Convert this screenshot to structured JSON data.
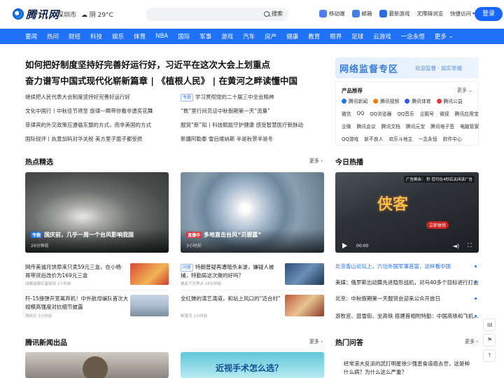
{
  "header": {
    "logo_text": "腾讯网",
    "location": "深圳市",
    "weather": "阴 29°C",
    "search_button": "搜索",
    "links": [
      {
        "label": "移动端",
        "icon": "mobile-icon",
        "color": "#4d7df0"
      },
      {
        "label": "邮箱",
        "icon": "mail-icon",
        "color": "#3f7fe8"
      },
      {
        "label": "最新游戏",
        "icon": "game-icon",
        "color": "#2d6be0"
      },
      {
        "label": "无障碍浏览",
        "icon": "",
        "color": ""
      },
      {
        "label": "快捷访问",
        "icon": "chevron-down-icon",
        "color": ""
      }
    ],
    "login_label": "登录"
  },
  "nav": [
    "要闻",
    "热问",
    "财经",
    "科技",
    "娱乐",
    "体育",
    "NBA",
    "国际",
    "军事",
    "游戏",
    "汽车",
    "房产",
    "健康",
    "教育",
    "眼界",
    "足球",
    "云游戏",
    "一念永恒",
    "更多"
  ],
  "headlines": [
    "如何把好制度坚持好完善好运行好，习近平在这次大会上划重点",
    "奋力谱写中国式现代化崭新篇章 | 《植根人民》 | 在黄河之畔读懂中国"
  ],
  "news_left": [
    "继续把人民代表大会制度坚持好完善好运行好",
    "文化中国行丨中秋佳节将至 旋律一瞬带你看非遗奕花舞",
    "菲律宾的外交政策应遵循东盟的方式，而非美国的方式",
    "国际锐评丨执意加码对华关税 美方里子面子都受损"
  ],
  "news_right": [
    {
      "tag": "专题",
      "text": "学习贯彻党的二十届三中全会精神"
    },
    {
      "tag": "",
      "text": "“数”里行间见证中秋假期第一天“流量”"
    },
    {
      "tag": "",
      "text": "服贸“新”知丨科技赋能守护健康 感受智慧医疗新脉动"
    },
    {
      "tag": "",
      "text": "新疆阿勒泰 雪后喀纳斯 半是秋景半是冬"
    }
  ],
  "promo": {
    "title": "网络监督专区",
    "subtitle": "欢迎监督 · 如实举报"
  },
  "products": {
    "title": "产品推荐",
    "more": "更多",
    "row1": [
      {
        "label": "腾讯新闻",
        "color": "#1e72f6"
      },
      {
        "label": "腾讯视频",
        "color": "#ff7a00"
      },
      {
        "label": "腾讯体育",
        "color": "#2b5be8"
      },
      {
        "label": "腾讯公益",
        "color": "#e63a3a"
      }
    ],
    "row2": [
      "微信",
      "QQ",
      "QQ浏览器",
      "QQ音乐",
      "企鹅号",
      "微视",
      "腾讯应用宝"
    ],
    "row3": [
      "企微",
      "腾讯会议",
      "腾讯文档",
      "腾讯元宝",
      "腾讯电子签",
      "电脑管家"
    ],
    "row4": [
      "QQ游戏",
      "新不良人",
      "欢乐斗地主",
      "一念永恒",
      "软件中心"
    ]
  },
  "sections": {
    "hot_picks": "热点精选",
    "hot_more": "更多",
    "today": "今日热播",
    "product_news": "腾讯新闻出品",
    "product_more": "更多",
    "qa": "热门问答",
    "qa_more": "更多"
  },
  "cards": [
    {
      "tag": "专题",
      "title": "国庆前，几乎一周一个台风影响我国",
      "meta": "26分钟前"
    },
    {
      "tag": "直播中",
      "title": "多地直击台风“贝碧嘉”",
      "meta": "3小时前"
    }
  ],
  "video": {
    "ad": "广告剩余：  秒   您可在4秒后关闭该广告",
    "time": "00:00",
    "title_art": "侠客",
    "cta": "立即体验"
  },
  "small_news": [
    {
      "text": "网传美诚月饼原来只卖59元三盒，在小杨哥带货后改价为169元三盒",
      "meta": "成都选报红星新闻  1小时前"
    },
    {
      "text": "歼-15接弹开室离弃机！中外航母编队首次大规模高强度对抗细节披露",
      "meta": "跳档见  2小时前"
    },
    {
      "tag": "问答",
      "text": "特朗普疑再遭暗杀未遂，嫌疑人被捕，特勤局这次做的好吗？",
      "meta": "看此下方界点  28分钟前"
    },
    {
      "text": "全红婵的演艺演道，和站上风口的“迈合村”",
      "meta": "帐篷河  1小时前"
    }
  ],
  "hot_list": [
    "北京香山论坛上，六位外国军事首富，这样看中国",
    "美媒：俄罗斯出动算先进隐形战机，对乌40多个目标进行打击",
    "北京：中秋假期第一天服贸会迎来公众开放日",
    "游牧宫、逛雪街、坐高铁 搭建首相附特勤：中国高铁和飞机..."
  ],
  "product_cards": [
    {
      "title": ""
    },
    {
      "title": "近视手术怎么选？"
    }
  ],
  "qa_list": [
    "经常滚大反派的武打明星徐少强患食道癌去世，这是种什么病？为什么这么严重？"
  ]
}
